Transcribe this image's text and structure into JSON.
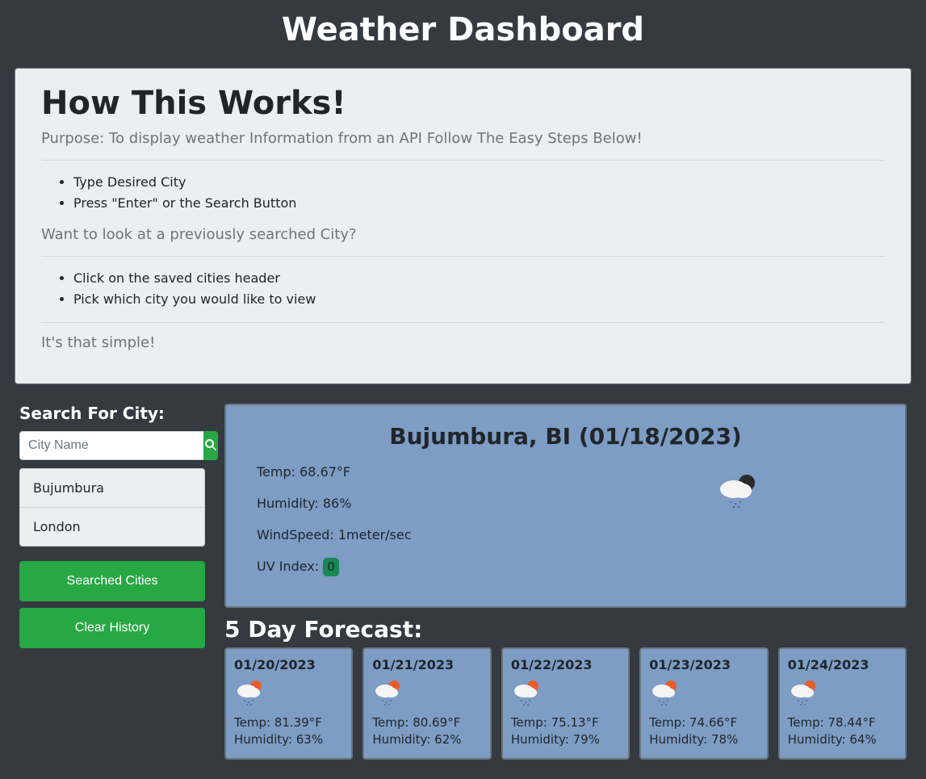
{
  "title": "Weather Dashboard",
  "instructions": {
    "heading": "How This Works!",
    "purpose": "Purpose: To display weather Information from an API Follow The Easy Steps Below!",
    "steps1": [
      "Type Desired City",
      "Press \"Enter\" or the Search Button"
    ],
    "prev_heading": "Want to look at a previously searched City?",
    "steps2": [
      "Click on the saved cities header",
      "Pick which city you would like to view"
    ],
    "closing": "It's that simple!"
  },
  "sidebar": {
    "label": "Search For City:",
    "placeholder": "City Name",
    "history": [
      "Bujumbura",
      "London"
    ],
    "searched_btn": "Searched Cities",
    "clear_btn": "Clear History"
  },
  "current": {
    "heading": "Bujumbura, BI (01/18/2023)",
    "temp_line": "Temp: 68.67°F",
    "humidity_line": "Humidity: 86%",
    "wind_line": "WindSpeed: 1meter/sec",
    "uv_label": "UV Index: ",
    "uv_value": "0",
    "icon": "moon-cloud-rain"
  },
  "forecast_title": "5 Day Forecast:",
  "forecast": [
    {
      "date": "01/20/2023",
      "temp": "Temp: 81.39°F",
      "humidity": "Humidity: 63%",
      "icon": "sun-cloud-rain"
    },
    {
      "date": "01/21/2023",
      "temp": "Temp: 80.69°F",
      "humidity": "Humidity: 62%",
      "icon": "sun-cloud-rain"
    },
    {
      "date": "01/22/2023",
      "temp": "Temp: 75.13°F",
      "humidity": "Humidity: 79%",
      "icon": "sun-cloud-rain"
    },
    {
      "date": "01/23/2023",
      "temp": "Temp: 74.66°F",
      "humidity": "Humidity: 78%",
      "icon": "sun-cloud-rain"
    },
    {
      "date": "01/24/2023",
      "temp": "Temp: 78.44°F",
      "humidity": "Humidity: 64%",
      "icon": "sun-cloud-rain"
    }
  ]
}
